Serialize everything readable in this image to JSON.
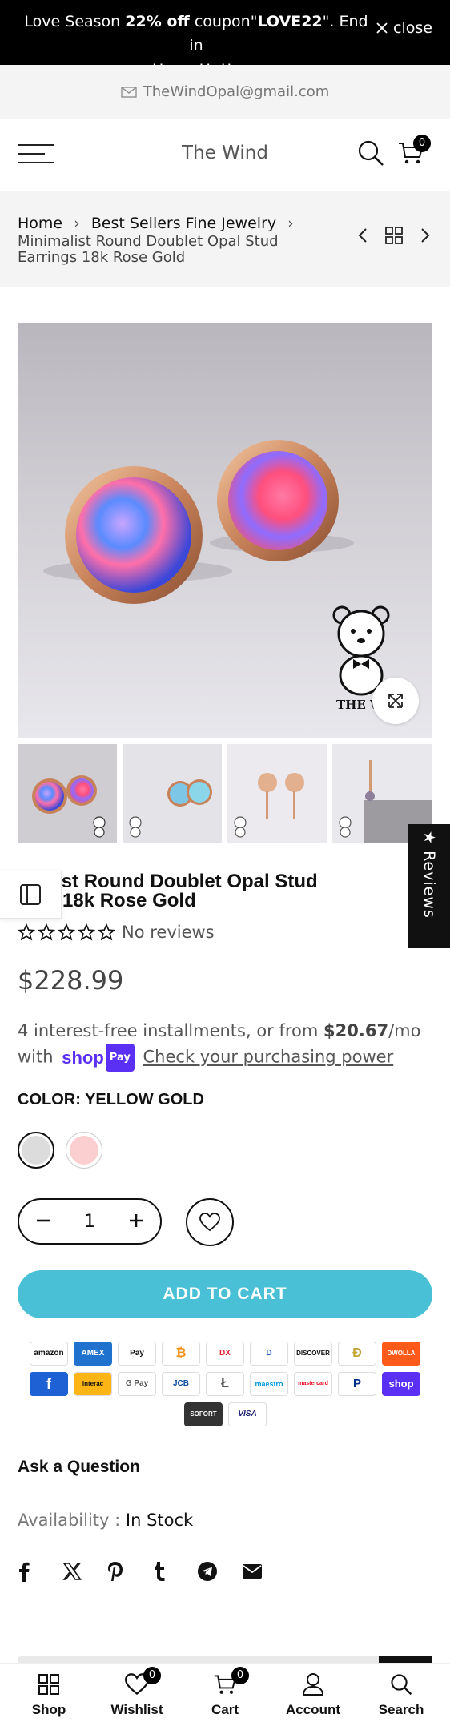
{
  "announcement": {
    "text_before": "Love Season ",
    "discount": "22% off",
    "text_mid": " coupon\"",
    "code": "LOVE22",
    "text_after": "\". End in",
    "line2": ". Hurry Up!! →",
    "close_label": "close"
  },
  "contact": {
    "email": "TheWindOpal@gmail.com"
  },
  "header": {
    "logo": "The Wind",
    "cart_count": "0"
  },
  "breadcrumb": {
    "home": "Home",
    "category": "Best Sellers Fine Jewelry",
    "current": "Minimalist Round Doublet Opal Stud Earrings 18k Rose Gold"
  },
  "gallery": {
    "watermark": "THE W"
  },
  "reviews_tab": {
    "label": "★ Reviews"
  },
  "product": {
    "title_visible": "imalist Round Doublet Opal Stud\nings 18k Rose Gold",
    "rating_label": "No reviews",
    "price": "$228.99",
    "installments_prefix": "4 interest-free installments, or from ",
    "installments_amount": "$20.67",
    "installments_suffix": "/mo",
    "installments_with": "with ",
    "shop_pay_shop": "shop",
    "shop_pay_pay": "Pay",
    "check_power": "Check your purchasing power",
    "color_label": "COLOR: YELLOW GOLD",
    "swatches": [
      {
        "name": "yellow-gold",
        "color": "#dcdcdc",
        "selected": true
      },
      {
        "name": "rose-gold",
        "color": "#fbcfcf",
        "selected": false
      }
    ],
    "quantity": "1",
    "add_to_cart": "ADD TO CART",
    "ask": "Ask a Question",
    "availability_label": "Availability : ",
    "availability_value": "In Stock"
  },
  "payment_methods": [
    "amazon",
    "AMEX",
    "Pay",
    "₿",
    "DX",
    "D",
    "DISCOVER",
    "Ð",
    "DWOLLA",
    "f",
    "interac",
    "G Pay",
    "JCB",
    "Ł",
    "maestro",
    "mastercard",
    "P",
    "shop",
    "SOFORT",
    "VISA"
  ],
  "toolbar": {
    "shop": "Shop",
    "wishlist": "Wishlist",
    "wishlist_count": "0",
    "cart": "Cart",
    "cart_count": "0",
    "account": "Account",
    "search": "Search"
  },
  "colors": {
    "accent": "#49c0d6",
    "shop_pay": "#5a31f4",
    "announcement_bg": "#000000",
    "bar_bg": "#f4f4f4"
  }
}
